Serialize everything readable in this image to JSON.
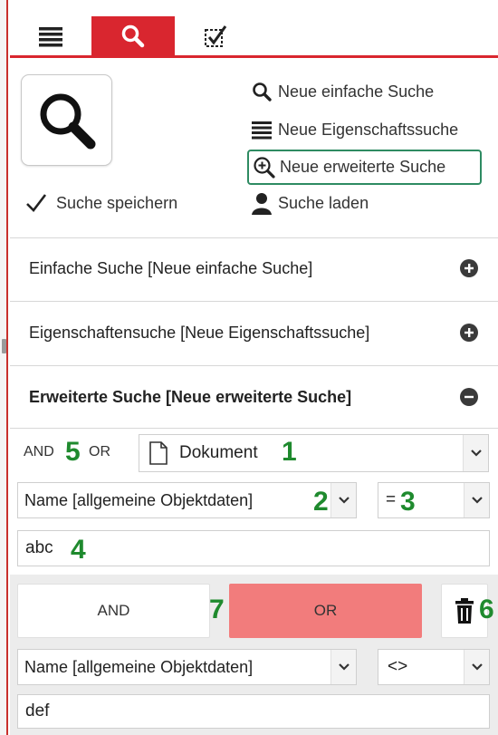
{
  "tabs": [
    {
      "icon": "list-icon",
      "active": false
    },
    {
      "icon": "search-icon",
      "active": true
    },
    {
      "icon": "checkbox-icon",
      "active": false
    }
  ],
  "actions": {
    "save_search": "Suche speichern",
    "new_simple": "Neue einfache Suche",
    "new_property": "Neue Eigenschaftssuche",
    "new_extended": "Neue erweiterte Suche",
    "load_search": "Suche laden"
  },
  "sections": [
    {
      "title": "Einfache Suche [Neue einfache Suche]",
      "expanded": false
    },
    {
      "title": "Eigenschaftensuche [Neue Eigenschaftssuche]",
      "expanded": false
    },
    {
      "title": "Erweiterte Suche [Neue erweiterte Suche]",
      "expanded": true
    }
  ],
  "extended": {
    "op_and": "AND",
    "op_or": "OR",
    "object_type": "Dokument",
    "row1": {
      "field": "Name [allgemeine Objektdaten]",
      "operator": "=",
      "value": "abc"
    },
    "group": {
      "and_label": "AND",
      "or_label": "OR",
      "active": "OR"
    },
    "row2": {
      "field": "Name [allgemeine Objektdaten]",
      "operator": "<>",
      "value": "def"
    }
  },
  "annotations": [
    "1",
    "2",
    "3",
    "4",
    "5",
    "6",
    "7"
  ],
  "colors": {
    "accent": "#d9262f",
    "highlight_border": "#2e8b62",
    "annotation": "#1f8a2e",
    "or_active": "#f27c7c"
  }
}
